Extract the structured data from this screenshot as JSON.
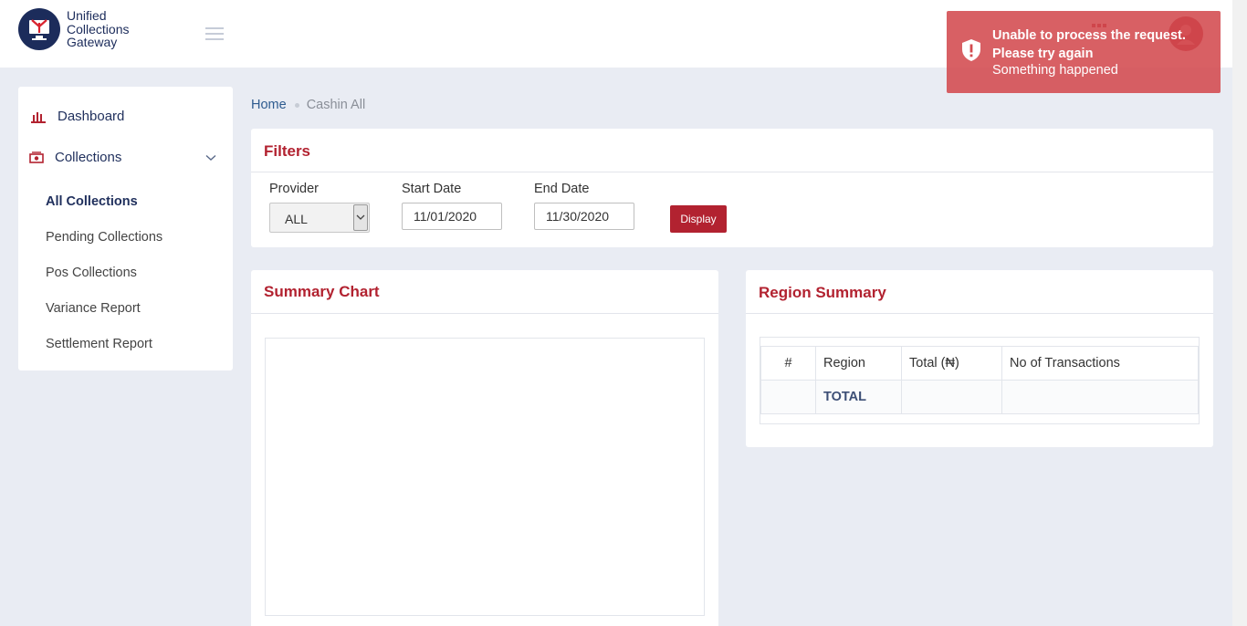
{
  "header": {
    "logo_text": [
      "Unified",
      "Collections",
      "Gateway"
    ]
  },
  "sidebar": {
    "items": [
      {
        "label": "Dashboard"
      },
      {
        "label": "Collections"
      }
    ],
    "sub_items": [
      {
        "label": "All Collections",
        "active": true
      },
      {
        "label": "Pending Collections"
      },
      {
        "label": "Pos Collections"
      },
      {
        "label": "Variance Report"
      },
      {
        "label": "Settlement Report"
      }
    ]
  },
  "breadcrumb": {
    "home": "Home",
    "current": "Cashin All"
  },
  "filters": {
    "title": "Filters",
    "provider": {
      "label": "Provider",
      "value": "ALL"
    },
    "start_date": {
      "label": "Start Date",
      "value": "11/01/2020"
    },
    "end_date": {
      "label": "End Date",
      "value": "11/30/2020"
    },
    "display_label": "Display"
  },
  "summary_chart": {
    "title": "Summary Chart"
  },
  "region_summary": {
    "title": "Region Summary",
    "columns": [
      "#",
      "Region",
      "Total (₦)",
      "No of Transactions"
    ],
    "total_label": "TOTAL"
  },
  "toast": {
    "title": "Unable to process the request. Please try again",
    "message": "Something happened"
  },
  "colors": {
    "brand_red": "#b22230",
    "brand_navy": "#1c2c5b",
    "toast_bg": "#d34a4e"
  }
}
